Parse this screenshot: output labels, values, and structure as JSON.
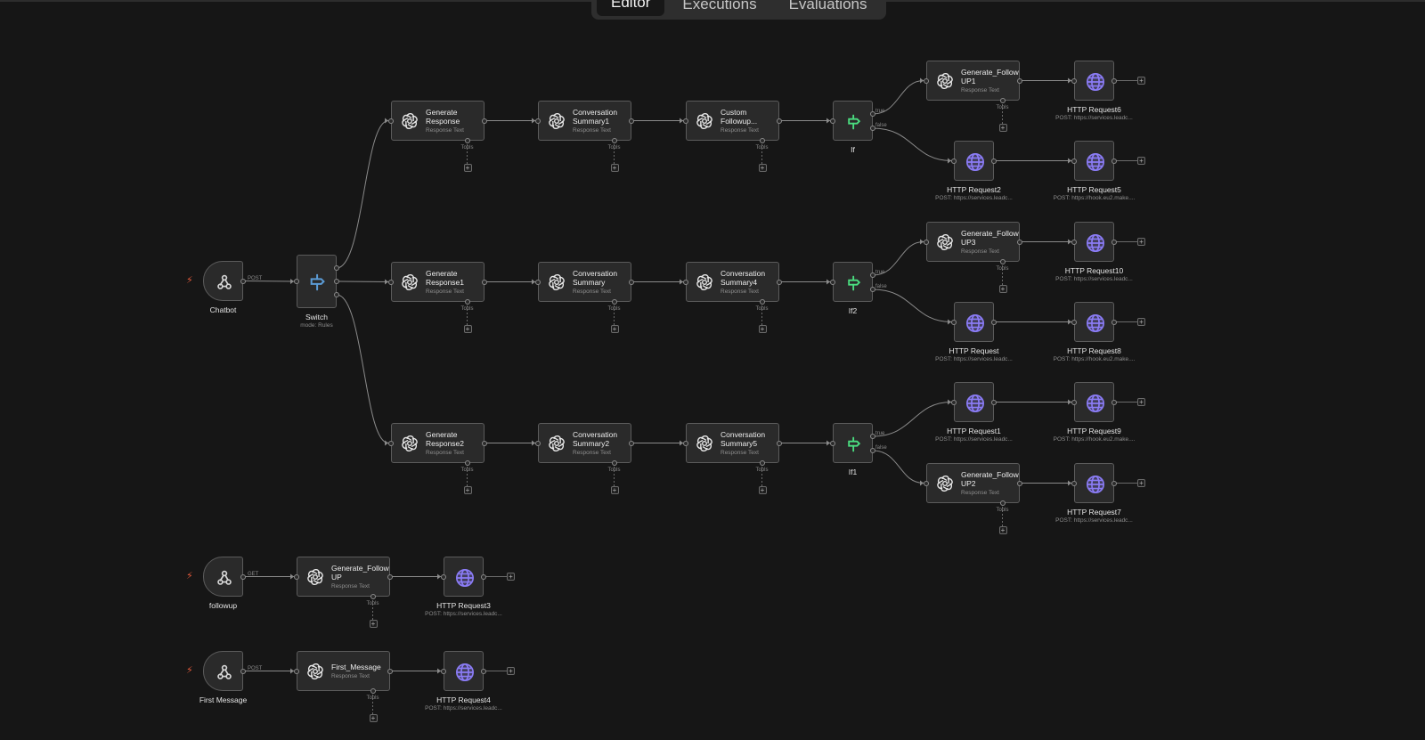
{
  "tabs": [
    {
      "label": "Editor",
      "active": true
    },
    {
      "label": "Executions",
      "active": false
    },
    {
      "label": "Evaluations",
      "active": false
    }
  ],
  "icons": {
    "trigger": "webhook-icon",
    "switch": "switch-icon",
    "ai": "openai-icon",
    "if": "if-icon",
    "http": "globe-icon"
  },
  "colors": {
    "background": "#161616",
    "node": "#2a2a2a",
    "http_icon": "#8b7cf6",
    "if_icon": "#4ade80",
    "switch_icon": "#5b9bd5",
    "bolt": "#e0583a"
  },
  "nodes": [
    {
      "id": "chatbot",
      "label": "Chatbot",
      "kind": "trigger"
    },
    {
      "id": "switch",
      "label": "Switch",
      "sub": "mode: Rules",
      "kind": "switch"
    },
    {
      "id": "gr",
      "title": "Generate\nResponse",
      "sub": "Response Text",
      "kind": "ai"
    },
    {
      "id": "cs1",
      "title": "Conversation\nSummary1",
      "sub": "Response Text",
      "kind": "ai"
    },
    {
      "id": "cf",
      "title": "Custom\nFollowup...",
      "sub": "Response Text",
      "kind": "ai"
    },
    {
      "id": "if",
      "label": "If",
      "kind": "if"
    },
    {
      "id": "gf1",
      "title": "Generate_Follow\nUP1",
      "sub": "Response Text",
      "kind": "ai"
    },
    {
      "id": "h6",
      "label": "HTTP Request6",
      "sub": "POST: https://services.leadc...",
      "kind": "http"
    },
    {
      "id": "h2",
      "label": "HTTP Request2",
      "sub": "POST: https://services.leadc...",
      "kind": "http"
    },
    {
      "id": "h5",
      "label": "HTTP Request5",
      "sub": "POST: https://hook.eu2.make....",
      "kind": "http"
    },
    {
      "id": "gr1",
      "title": "Generate\nResponse1",
      "sub": "Response Text",
      "kind": "ai"
    },
    {
      "id": "cs",
      "title": "Conversation\nSummary",
      "sub": "Response Text",
      "kind": "ai"
    },
    {
      "id": "cs4",
      "title": "Conversation\nSummary4",
      "sub": "Response Text",
      "kind": "ai"
    },
    {
      "id": "if2",
      "label": "If2",
      "kind": "if"
    },
    {
      "id": "gf3",
      "title": "Generate_Follow\nUP3",
      "sub": "Response Text",
      "kind": "ai"
    },
    {
      "id": "h10",
      "label": "HTTP Request10",
      "sub": "POST: https://services.leadc...",
      "kind": "http"
    },
    {
      "id": "h",
      "label": "HTTP Request",
      "sub": "POST: https://services.leadc...",
      "kind": "http"
    },
    {
      "id": "h8",
      "label": "HTTP Request8",
      "sub": "POST: https://hook.eu2.make....",
      "kind": "http"
    },
    {
      "id": "gr2",
      "title": "Generate\nResponse2",
      "sub": "Response Text",
      "kind": "ai"
    },
    {
      "id": "cs2",
      "title": "Conversation\nSummary2",
      "sub": "Response Text",
      "kind": "ai"
    },
    {
      "id": "cs5",
      "title": "Conversation\nSummary5",
      "sub": "Response Text",
      "kind": "ai"
    },
    {
      "id": "if1",
      "label": "If1",
      "kind": "if"
    },
    {
      "id": "h1",
      "label": "HTTP Request1",
      "sub": "POST: https://services.leadc...",
      "kind": "http"
    },
    {
      "id": "h9",
      "label": "HTTP Request9",
      "sub": "POST: https://hook.eu2.make....",
      "kind": "http"
    },
    {
      "id": "gf2",
      "title": "Generate_Follow\nUP2",
      "sub": "Response Text",
      "kind": "ai"
    },
    {
      "id": "h7",
      "label": "HTTP Request7",
      "sub": "POST: https://services.leadc...",
      "kind": "http"
    },
    {
      "id": "followup",
      "label": "followup",
      "kind": "trigger"
    },
    {
      "id": "gfu",
      "title": "Generate_Follow\nUP",
      "sub": "Response Text",
      "kind": "ai"
    },
    {
      "id": "h3",
      "label": "HTTP Request3",
      "sub": "POST: https://services.leadc...",
      "kind": "http"
    },
    {
      "id": "firstmsg",
      "label": "First Message",
      "kind": "trigger"
    },
    {
      "id": "fm",
      "title": "First_Message",
      "sub": "Response Text",
      "kind": "ai"
    },
    {
      "id": "h4",
      "label": "HTTP Request4",
      "sub": "POST: https://services.leadc...",
      "kind": "http"
    }
  ],
  "edge_labels": {
    "post": "POST",
    "get": "GET",
    "true": "true",
    "false": "false",
    "tools": "Tools",
    "plus": "+"
  }
}
